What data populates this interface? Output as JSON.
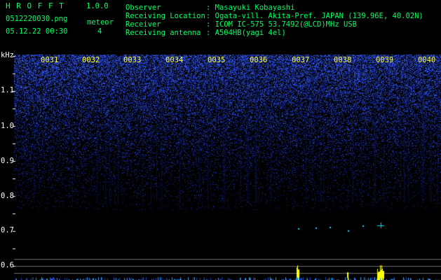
{
  "header": {
    "app_name": "H R O F F T",
    "version": "1.0.0",
    "filename": "0512220030.png",
    "meteor_label": "meteor",
    "meteor_count": "4",
    "datetime": "05.12.22 00:30",
    "info": [
      {
        "label": "Observer",
        "value": ": Masayuki Kobayashi"
      },
      {
        "label": "Receiving Location",
        "value": ": Ogata-vill. Akita-Pref. JAPAN (139.96E, 40.02N)"
      },
      {
        "label": "Receiver",
        "value": ": ICOM IC-575 53.7492(@LCD)MHz USB"
      },
      {
        "label": "Receiving antenna",
        "value": ": A504HB(yagi 4el)"
      }
    ]
  },
  "spectrogram": {
    "unit_label": "kHz",
    "time_labels": [
      "0031",
      "0032",
      "0033",
      "0034",
      "0035",
      "0036",
      "0037",
      "0038",
      "0039",
      "0040"
    ],
    "freq_labels": [
      "1.1",
      "1.0",
      "0.9",
      "0.8",
      "0.7",
      "0.6"
    ],
    "colors": {
      "noise": "#3040ff",
      "line": "#ffffff",
      "burst": "#ffff00",
      "echo": "#00e0ff"
    }
  }
}
